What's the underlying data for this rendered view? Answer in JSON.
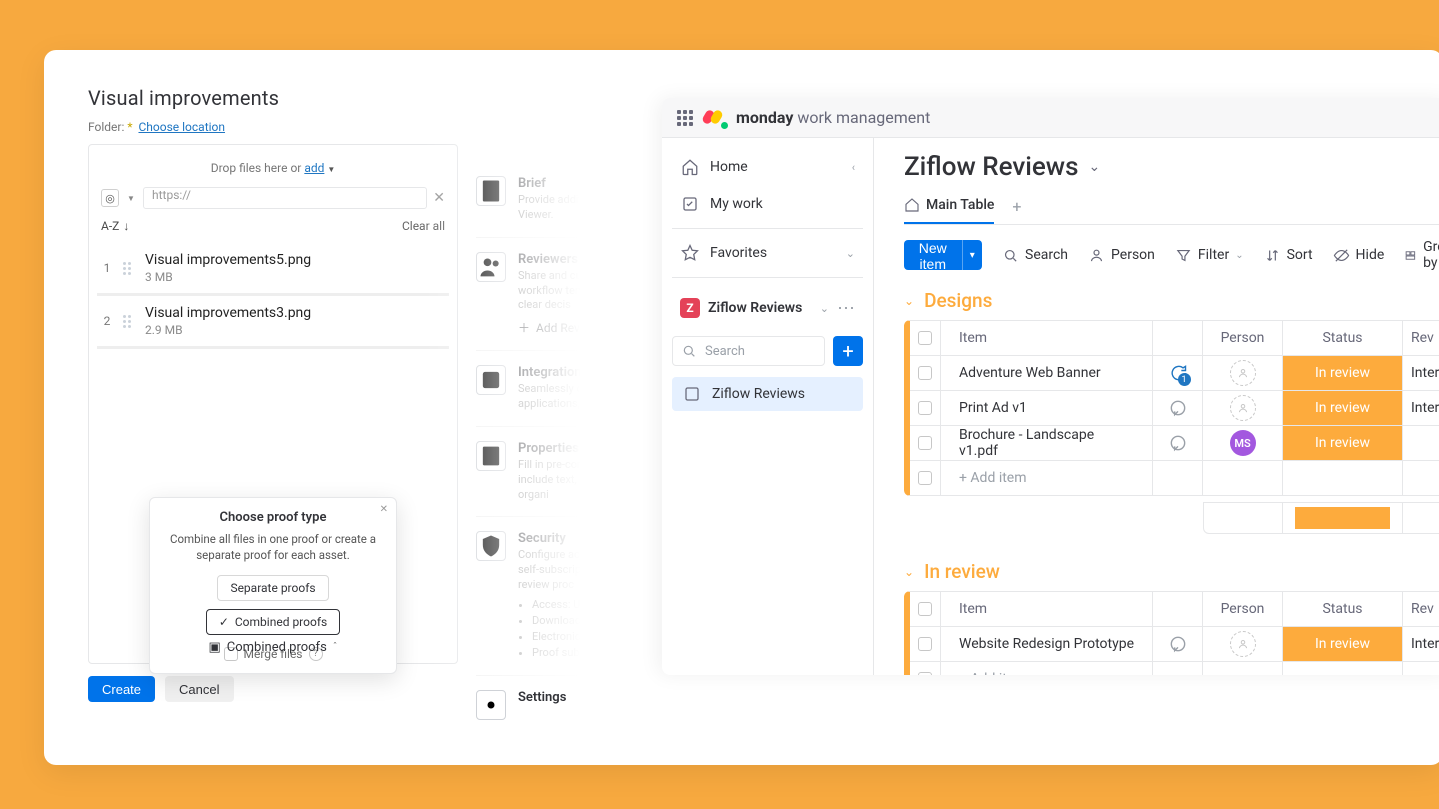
{
  "left": {
    "title": "Visual improvements",
    "folder_label": "Folder:",
    "folder_required": "*",
    "folder_link": "Choose location",
    "drop_text_a": "Drop files here or ",
    "drop_link": "add",
    "url_value": "https://",
    "sort_label": "A-Z",
    "clear_all": "Clear all",
    "files": [
      {
        "name": "Visual improvements5.png",
        "size": "3 MB"
      },
      {
        "name": "Visual improvements3.png",
        "size": "2.9 MB"
      }
    ],
    "popup": {
      "title": "Choose proof type",
      "desc": "Combine all files in one proof or create a separate proof for each asset.",
      "separate": "Separate proofs",
      "combined": "Combined proofs",
      "merge": "Merge files"
    },
    "combined_footer": "Combined proofs",
    "create": "Create",
    "cancel": "Cancel"
  },
  "mid": {
    "brief": {
      "title": "Brief",
      "desc": "Provide additional info\nZiflow Viewer."
    },
    "reviewers": {
      "title": "Reviewers",
      "desc": "Share and customize\nUse workflow templ\nemails and clear decis",
      "add": "Add Reviewers"
    },
    "integrations": {
      "title": "Integrations",
      "desc": "Seamlessly connect a\napplications, streamlin"
    },
    "properties": {
      "title": "Properties",
      "desc": "Fill in pre-configured\ncould include text, da\nenhance asset organi"
    },
    "security": {
      "title": "Security",
      "desc": "Configure access auth\nenable self-subscriptio\ncompliant review proc",
      "bullets": [
        "Access: Users & Gu",
        "Download of the or",
        "Electronic signatur",
        "Proof subscriptions"
      ]
    },
    "settings": {
      "title": "Settings",
      "desc": ""
    }
  },
  "monday": {
    "brand_bold": "monday",
    "brand_rest": " work management",
    "sidebar": {
      "home": "Home",
      "mywork": "My work",
      "favorites": "Favorites",
      "workspace": "Ziflow Reviews",
      "search_ph": "Search",
      "board": "Ziflow Reviews"
    },
    "board_title": "Ziflow Reviews",
    "tab_main": "Main Table",
    "toolbar": {
      "new_item": "New item",
      "search": "Search",
      "person": "Person",
      "filter": "Filter",
      "sort": "Sort",
      "hide": "Hide",
      "group_by": "Group by"
    },
    "groups": [
      {
        "name": "Designs",
        "headers": {
          "item": "Item",
          "person": "Person",
          "status": "Status",
          "rev": "Rev"
        },
        "rows": [
          {
            "item": "Adventure Web Banner",
            "status": "In review",
            "rev": "Inter",
            "chat_badge": true,
            "avatar": "empty"
          },
          {
            "item": "Print Ad v1",
            "status": "In review",
            "rev": "Inter",
            "chat_badge": false,
            "avatar": "empty"
          },
          {
            "item": "Brochure - Landscape v1.pdf",
            "status": "In review",
            "rev": "",
            "chat_badge": false,
            "avatar": "MS"
          }
        ],
        "add_item": "+ Add item"
      },
      {
        "name": "In review",
        "headers": {
          "item": "Item",
          "person": "Person",
          "status": "Status",
          "rev": "Rev"
        },
        "rows": [
          {
            "item": "Website Redesign Prototype",
            "status": "In review",
            "rev": "Inter",
            "chat_badge": false,
            "avatar": "empty"
          }
        ],
        "add_item": "+ Add item"
      }
    ]
  }
}
